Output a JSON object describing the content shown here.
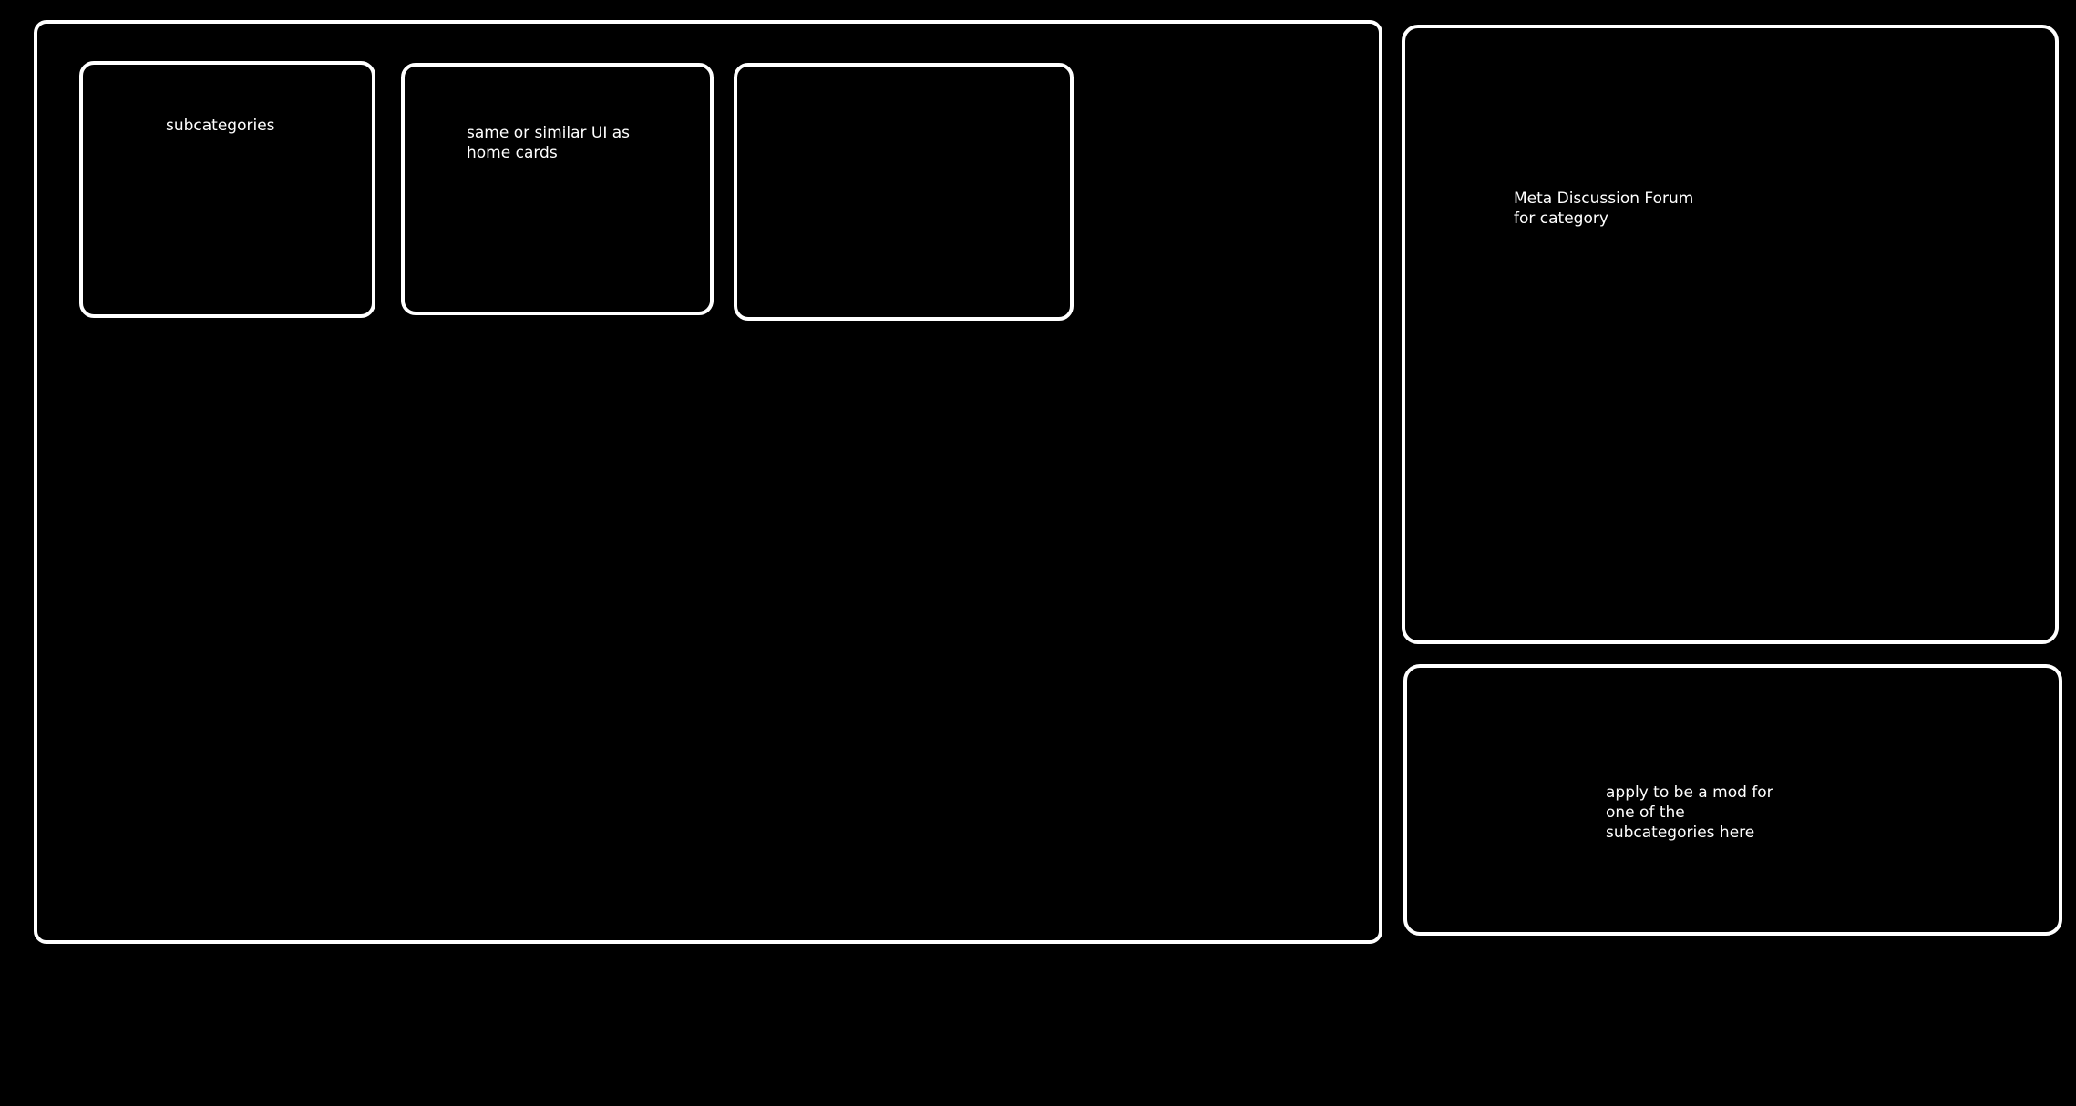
{
  "main": {
    "cards": [
      {
        "text": "subcategories"
      },
      {
        "text": "same or similar UI as\nhome cards"
      },
      {
        "text": ""
      }
    ]
  },
  "sidebar": {
    "forum": {
      "text": "Meta Discussion Forum\nfor category"
    },
    "mod_application": {
      "text": "apply to be a mod for\none of the\nsubcategories here"
    }
  },
  "colors": {
    "background": "#000000",
    "outline": "#ffffff",
    "text": "#ffffff"
  }
}
